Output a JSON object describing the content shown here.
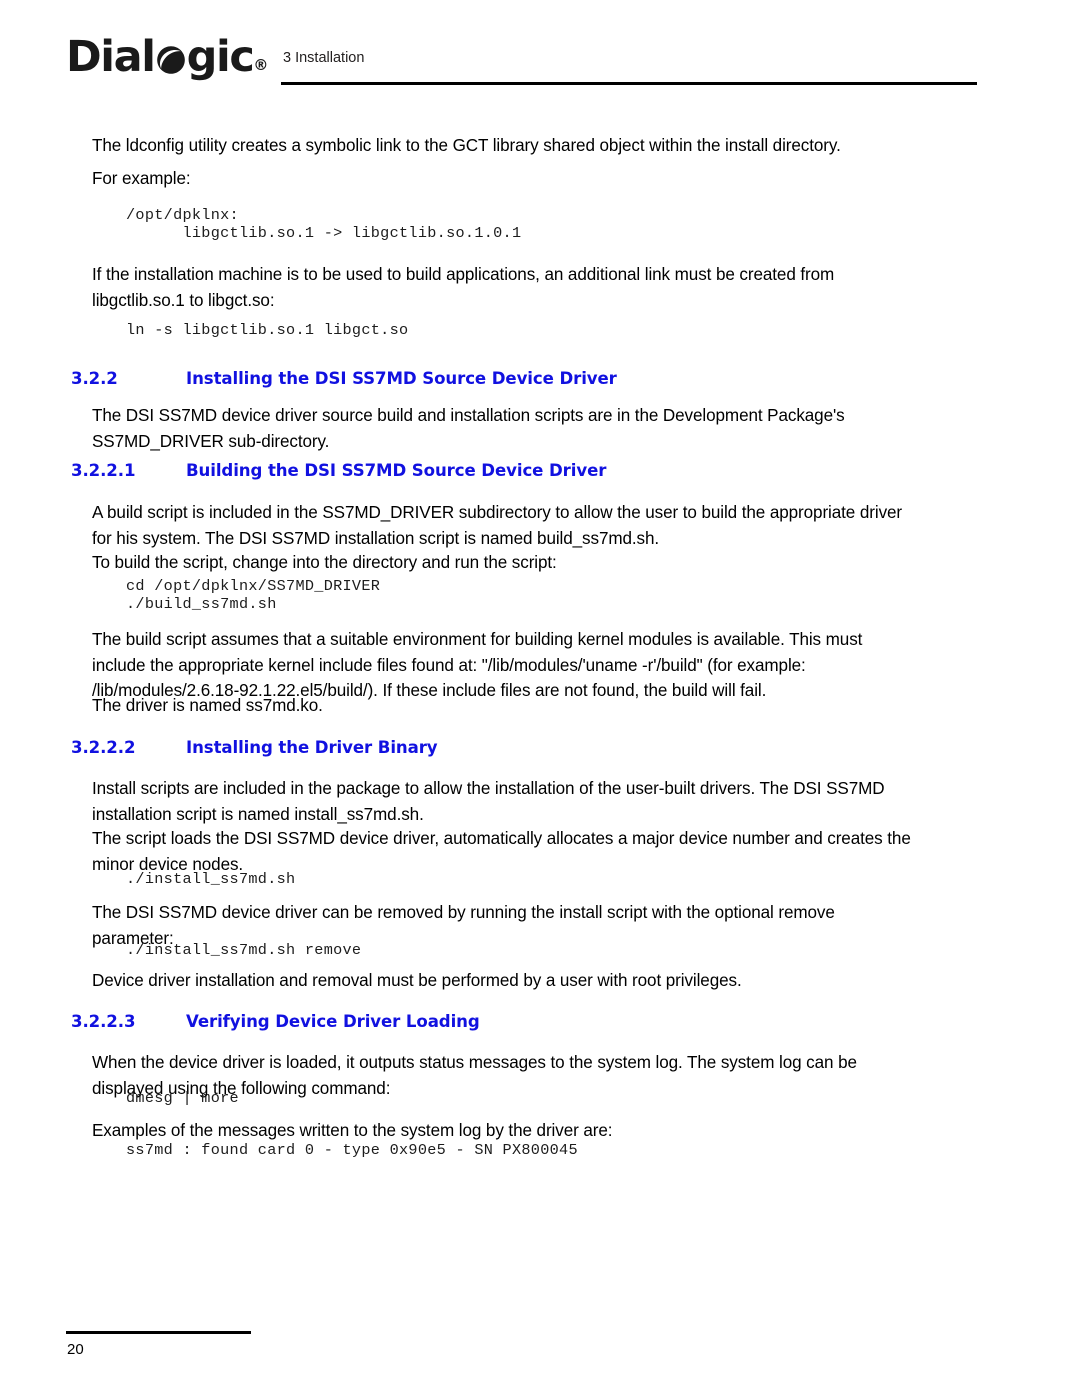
{
  "header": {
    "logo_text_1": "Dial",
    "logo_icon": "dialogic-o-logo-icon",
    "logo_text_2": "gic",
    "logo_registered": "®",
    "chapter": "3 Installation"
  },
  "body": {
    "p1": "The ldconfig utility creates a symbolic link to the GCT library shared object within the install directory.",
    "p2": "For example:",
    "code1_line1": "/opt/dpklnx:",
    "code1_line2": "      libgctlib.so.1 -> libgctlib.so.1.0.1",
    "p3": "If the installation machine is to be used to build applications, an additional link must be created from libgctlib.so.1 to libgct.so:",
    "code2": "ln -s libgctlib.so.1 libgct.so",
    "h322_num": "3.2.2",
    "h322_title": "Installing the DSI SS7MD Source Device Driver",
    "p4": "The DSI SS7MD device driver source build and installation scripts are in the Development Package's SS7MD_DRIVER sub-directory.",
    "h3221_num": "3.2.2.1",
    "h3221_title": "Building the DSI SS7MD Source Device Driver",
    "p5": "A build script is included in the SS7MD_DRIVER subdirectory to allow the user to build the appropriate driver for his system. The DSI SS7MD installation script is named build_ss7md.sh.",
    "p6": "To build the script, change into the directory and run the script:",
    "code3_line1": "cd /opt/dpklnx/SS7MD_DRIVER",
    "code3_line2": "./build_ss7md.sh",
    "p7": "The build script assumes that a suitable environment for building kernel modules is available. This must include the appropriate kernel include files found at: \"/lib/modules/'uname -r'/build\" (for example: /lib/modules/2.6.18-92.1.22.el5/build/). If these include files are not found, the build will fail.",
    "p8": "The driver is named ss7md.ko.",
    "h3222_num": "3.2.2.2",
    "h3222_title": "Installing the Driver Binary",
    "p9": "Install scripts are included in the package to allow the installation of the user-built drivers. The DSI SS7MD installation script is named install_ss7md.sh.",
    "p10": "The script loads the DSI SS7MD device driver, automatically allocates a major device number and creates the minor device nodes.",
    "code4": "./install_ss7md.sh",
    "p11": "The DSI SS7MD device driver can be removed by running the install script with the optional remove parameter:",
    "code5": "./install_ss7md.sh remove",
    "p12": "Device driver installation and removal must be performed by a user with root privileges.",
    "h3223_num": "3.2.2.3",
    "h3223_title": "Verifying Device Driver Loading",
    "p13": "When the device driver is loaded, it outputs status messages to the system log. The system log can be displayed using the following command:",
    "code6": "dmesg | more",
    "p14": "Examples of the messages written to the system log by the driver are:",
    "code7": "ss7md : found card 0 - type 0x90e5 - SN PX800045"
  },
  "footer": {
    "page_number": "20"
  },
  "colors": {
    "heading_blue": "#1111e0",
    "text_black": "#000000",
    "rule_black": "#000000"
  }
}
